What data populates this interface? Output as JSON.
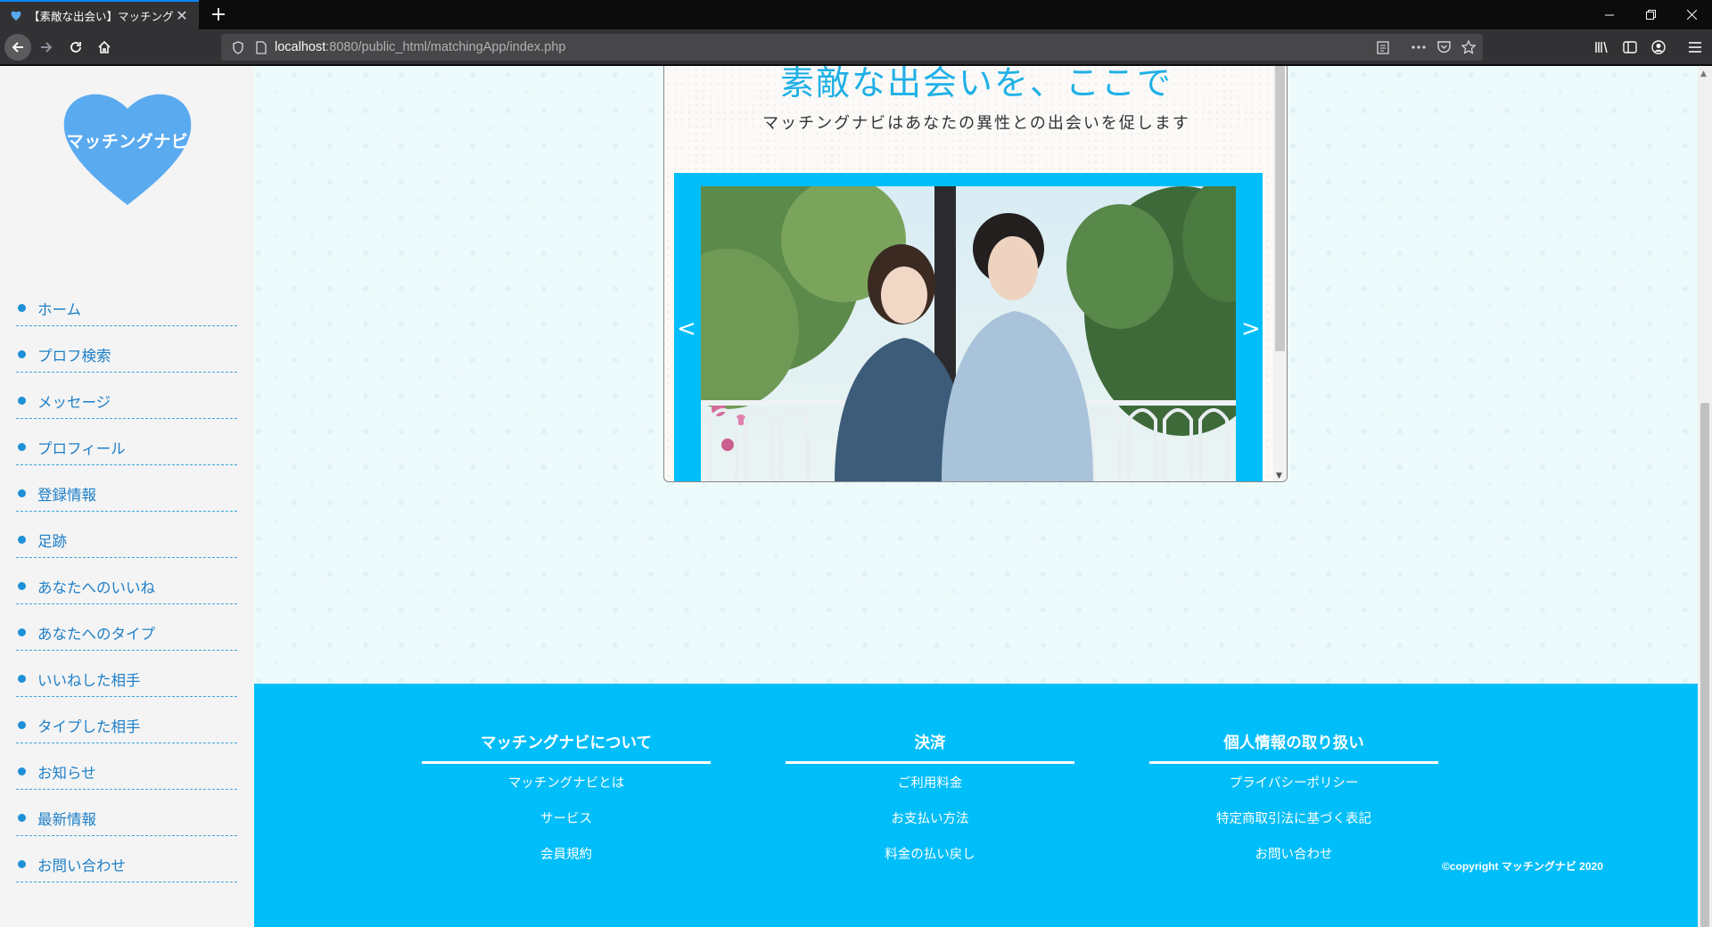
{
  "browser": {
    "tab_title": "【素敵な出会い】マッチングナビ！",
    "url_host": "localhost",
    "url_rest": ":8080/public_html/matchingApp/index.php"
  },
  "sidebar": {
    "logo_text": "マッチングナビ",
    "items": [
      {
        "label": "ホーム"
      },
      {
        "label": "プロフ検索"
      },
      {
        "label": "メッセージ"
      },
      {
        "label": "プロフィール"
      },
      {
        "label": "登録情報"
      },
      {
        "label": "足跡"
      },
      {
        "label": "あなたへのいいね"
      },
      {
        "label": "あなたへのタイプ"
      },
      {
        "label": "いいねした相手"
      },
      {
        "label": "タイプした相手"
      },
      {
        "label": "お知らせ"
      },
      {
        "label": "最新情報"
      },
      {
        "label": "お問い合わせ"
      }
    ]
  },
  "hero": {
    "title": "素敵な出会いを、ここで",
    "subtitle": "マッチングナビはあなたの異性との出会いを促します",
    "prev_arrow": "<",
    "next_arrow": ">"
  },
  "footer": {
    "columns": [
      {
        "title": "マッチングナビについて",
        "links": [
          "マッチングナビとは",
          "サービス",
          "会員規約"
        ]
      },
      {
        "title": "決済",
        "links": [
          "ご利用料金",
          "お支払い方法",
          "料金の払い戻し"
        ]
      },
      {
        "title": "個人情報の取り扱い",
        "links": [
          "プライバシーポリシー",
          "特定商取引法に基づく表記",
          "お問い合わせ"
        ]
      }
    ],
    "copyright": "©copyright マッチングナビ 2020"
  },
  "colors": {
    "accent": "#00bef9",
    "link": "#1e7fc8",
    "logo_heart": "#5aaaf0"
  },
  "icons": {
    "favicon": "heart-icon",
    "back": "arrow-left-icon",
    "forward": "arrow-right-icon",
    "reload": "reload-icon",
    "home": "home-icon",
    "shield": "shield-icon",
    "page": "page-icon",
    "reader": "reader-view-icon",
    "more": "more-icon",
    "pocket": "pocket-icon",
    "bookmark": "star-icon",
    "library": "library-icon",
    "sidebar": "sidebar-icon",
    "account": "account-icon",
    "menu": "hamburger-menu-icon"
  }
}
